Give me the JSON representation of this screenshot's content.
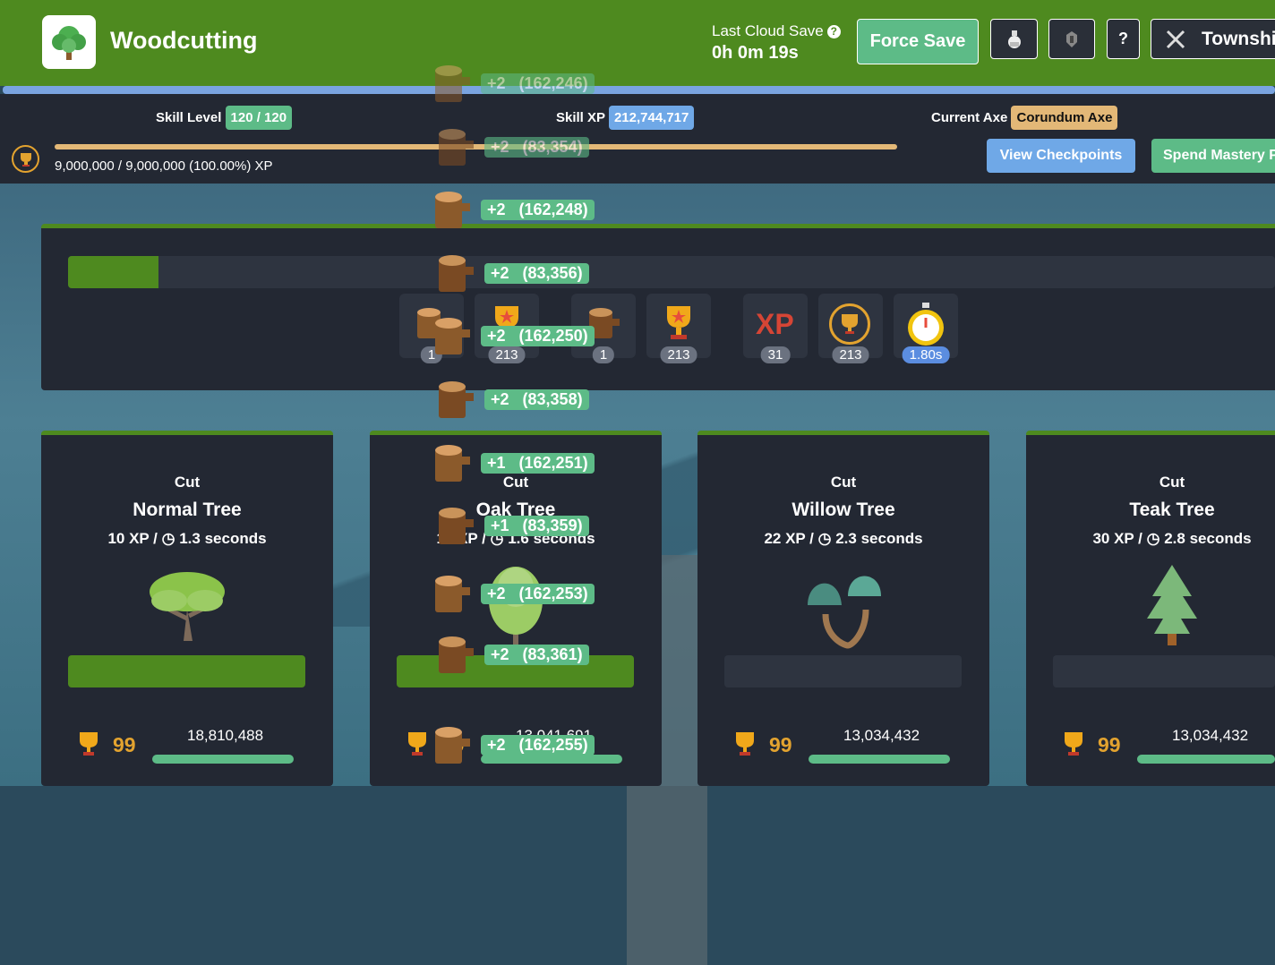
{
  "header": {
    "title": "Woodcutting",
    "save_label": "Last Cloud Save",
    "save_help": "?",
    "save_time": "0h 0m 19s",
    "force_save": "Force Save",
    "help_button": "?",
    "township_button": "Townshi",
    "icons": [
      "tree-icon",
      "potion-icon",
      "equipment-icon",
      "crossed-swords-icon"
    ]
  },
  "skill": {
    "level_label": "Skill Level",
    "level_value": "120 / 120",
    "xp_label": "Skill XP",
    "xp_value": "212,744,717",
    "axe_label": "Current Axe",
    "axe_value": "Corundum Axe",
    "progress_text": "9,000,000 / 9,000,000 (100.00%) XP",
    "progress_fraction": 1.0,
    "view_checkpoints": "View Checkpoints",
    "spend_mastery": "Spend Mastery P"
  },
  "panel": {
    "progress_fraction": 0.075,
    "stats": [
      {
        "icon": "logs-icon",
        "count": "1"
      },
      {
        "icon": "trophy-star-icon",
        "count": "213"
      },
      {
        "icon": "logs-icon",
        "count": "1"
      },
      {
        "icon": "trophy-icon",
        "count": "213"
      },
      {
        "icon": "xp-icon",
        "label": "XP",
        "count": "31"
      },
      {
        "icon": "mastery-trophy-icon",
        "count": "213"
      },
      {
        "icon": "stopwatch-icon",
        "count": "1.80s"
      }
    ]
  },
  "trees": [
    {
      "cut": "Cut",
      "name": "Normal Tree",
      "xp": "10 XP /",
      "time": "1.3 seconds",
      "mastery": "99",
      "xp_total": "18,810,488",
      "active": true
    },
    {
      "cut": "Cut",
      "name": "Oak Tree",
      "xp": "15 XP /",
      "time": "1.6 seconds",
      "mastery": "99",
      "xp_total": "13,041,691",
      "active": true
    },
    {
      "cut": "Cut",
      "name": "Willow Tree",
      "xp": "22 XP /",
      "time": "2.3 seconds",
      "mastery": "99",
      "xp_total": "13,034,432",
      "active": false
    },
    {
      "cut": "Cut",
      "name": "Teak Tree",
      "xp": "30 XP /",
      "time": "2.8 seconds",
      "mastery": "99",
      "xp_total": "13,034,432",
      "active": false
    }
  ],
  "drops": [
    {
      "text": "+2   (162,246)"
    },
    {
      "text": "+2   (83,354)"
    },
    {
      "text": "+2   (162,248)"
    },
    {
      "text": "+2   (83,356)"
    },
    {
      "text": "+2   (162,250)"
    },
    {
      "text": "+2   (83,358)"
    },
    {
      "text": "+1   (162,251)"
    },
    {
      "text": "+1   (83,359)"
    },
    {
      "text": "+2   (162,253)"
    },
    {
      "text": "+2   (83,361)"
    },
    {
      "text": "+2   (162,255)"
    }
  ],
  "colors": {
    "header_green": "#4e8a1f",
    "accent_green": "#5dbb87",
    "accent_blue": "#6fa8e7",
    "gold": "#e3b877",
    "panel_dark": "#232833"
  }
}
